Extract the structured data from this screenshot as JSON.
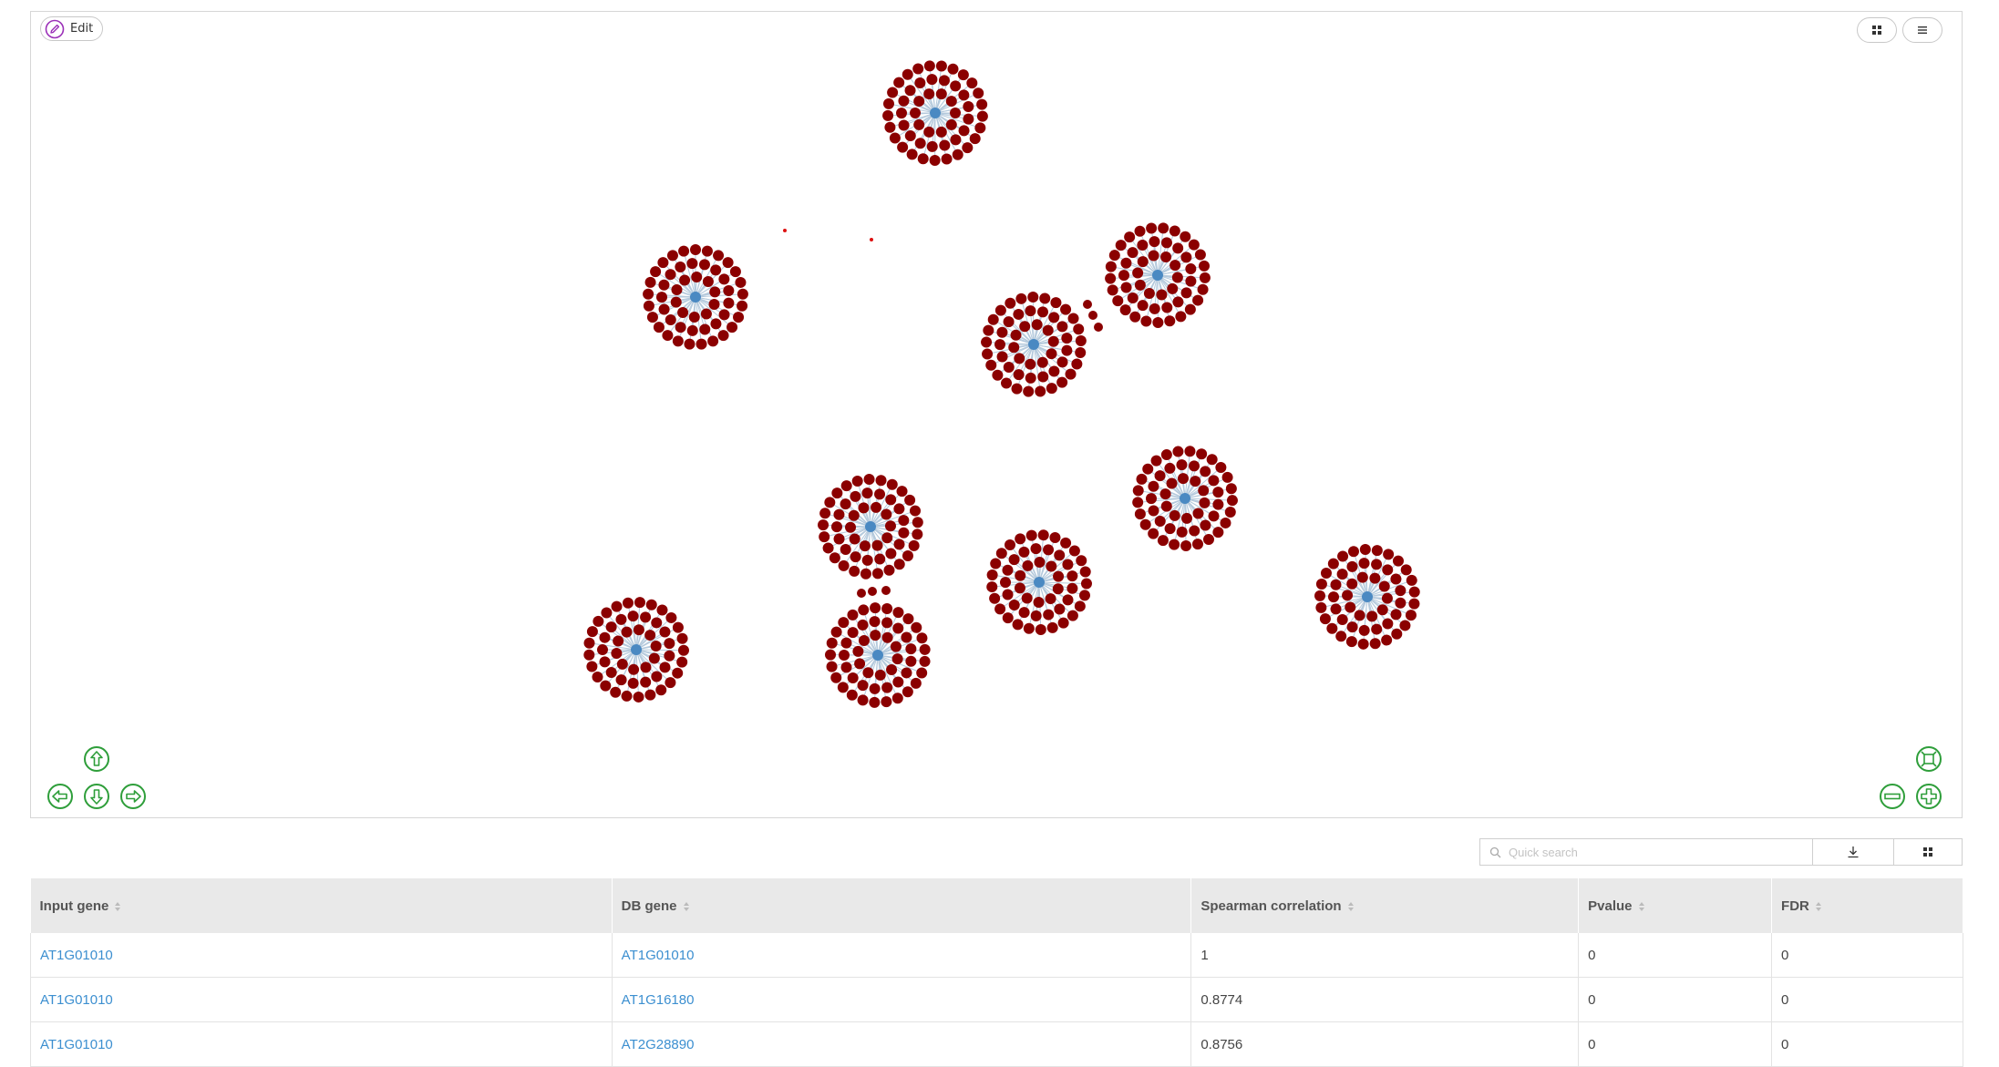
{
  "toolbar": {
    "edit_label": "Edit"
  },
  "search": {
    "placeholder": "Quick search"
  },
  "colors": {
    "node_center": "#4a89c2",
    "node_leaf": "#8b0000",
    "edge": "#b4c9dc",
    "nav_icon": "#2e9e3a",
    "link": "#3c8fd0",
    "edit_icon": "#9b30b8"
  },
  "icons": {
    "edit": "pencil-circle-icon",
    "layout": "grid-icon",
    "menu": "hamburger-icon",
    "pan_up": "arrow-up-circle-icon",
    "pan_left": "arrow-left-circle-icon",
    "pan_down": "arrow-down-circle-icon",
    "pan_right": "arrow-right-circle-icon",
    "fit": "fit-screen-icon",
    "zoom_out": "minus-circle-icon",
    "zoom_in": "plus-circle-icon",
    "search": "search-icon",
    "download": "download-icon",
    "columns": "grid-icon"
  },
  "table": {
    "headers": [
      "Input gene",
      "DB gene",
      "Spearman correlation",
      "Pvalue",
      "FDR"
    ],
    "rows": [
      [
        "AT1G01010",
        "AT1G01010",
        "1",
        "0",
        "0"
      ],
      [
        "AT1G01010",
        "AT1G16180",
        "0.8774",
        "0",
        "0"
      ],
      [
        "AT1G01010",
        "AT2G28890",
        "0.8756",
        "0",
        "0"
      ]
    ]
  }
}
